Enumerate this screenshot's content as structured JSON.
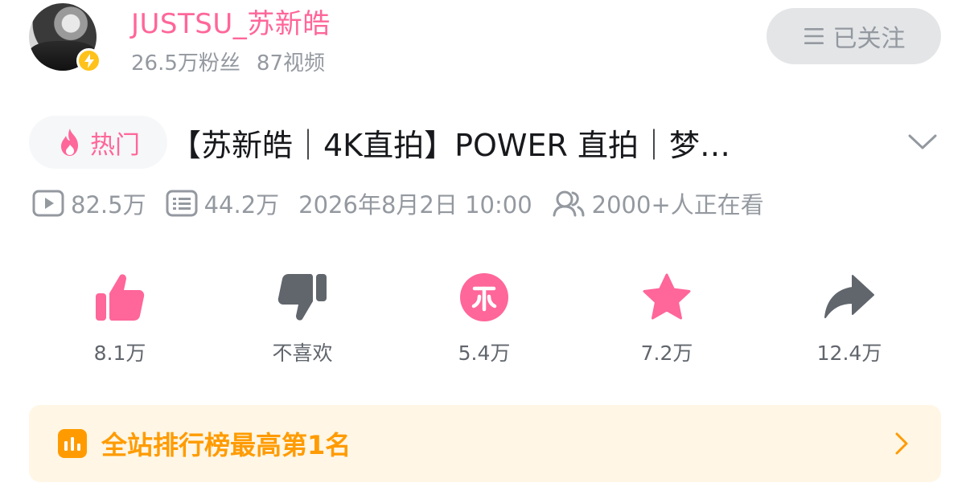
{
  "uploader": {
    "name": "JUSTSU_苏新皓",
    "followers": "26.5万粉丝",
    "videos": "87视频",
    "follow_label": "已关注"
  },
  "video": {
    "hot_label": "热门",
    "title": "【苏新皓｜4K直拍】POWER 直拍｜梦…",
    "views": "82.5万",
    "danmaku": "44.2万",
    "date": "2026年8月2日 10:00",
    "watching": "2000+人正在看"
  },
  "actions": [
    {
      "name": "like",
      "label": "8.1万",
      "icon": "thumbs-up-icon",
      "color": "#ff6699"
    },
    {
      "name": "dislike",
      "label": "不喜欢",
      "icon": "thumbs-down-icon",
      "color": "#61666d"
    },
    {
      "name": "coin",
      "label": "5.4万",
      "icon": "coin-icon",
      "color": "#ff6699"
    },
    {
      "name": "favorite",
      "label": "7.2万",
      "icon": "star-icon",
      "color": "#ff6699"
    },
    {
      "name": "share",
      "label": "12.4万",
      "icon": "share-icon",
      "color": "#61666d"
    }
  ],
  "ranking": {
    "text": "全站排行榜最高第1名",
    "color": "#ff9b00"
  }
}
